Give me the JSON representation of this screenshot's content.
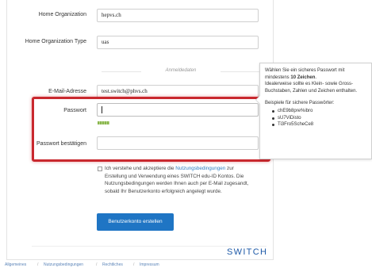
{
  "form": {
    "home_org_label": "Home Organization",
    "home_org_value": "hepvs.ch",
    "home_org_type_label": "Home Organization Type",
    "home_org_type_value": "uas",
    "section_title": "Anmeldedaten",
    "email_label": "E-Mail-Adresse",
    "email_value": "test.switch@phvs.ch",
    "password_label": "Passwort",
    "password_value": "",
    "password_confirm_label": "Passwort bestätigen",
    "password_confirm_value": "",
    "password_strength": 0.15,
    "terms_prefix": "Ich verstehe und akzeptiere die ",
    "terms_link": "Nutzungsbedingungen",
    "terms_suffix": " zur Erstellung und Verwendung eines SWITCH edu-ID Kontos. Die Nutzungsbedingungen werden Ihnen auch per E-Mail zugesandt, sobald Ihr Benutzerkonto erfolgreich angelegt wurde.",
    "terms_checked": false,
    "submit_label": "Benutzerkonto erstellen"
  },
  "tooltip": {
    "line1_prefix": "Wählen Sie ein sicheres Passwort mit mindestens ",
    "line1_bold": "10 Zeichen",
    "line1_suffix": ".",
    "line2": "Idealerweise sollte es Klein- sowie Gross-Buchstaben, Zahlen und Zeichen enthalten.",
    "examples_head": "Beispiele für sichere Passwörter:",
    "examples": [
      "chE9b8pre%ibro",
      "sU7ViDisto",
      "Ti3Fro5ScheCe8"
    ]
  },
  "brand": {
    "name": "SWITCH",
    "color": "#1e5aa8"
  },
  "footer": {
    "links": [
      "Allgemeines",
      "Nutzungsbedingungen",
      "Rechtliches",
      "Impressum"
    ],
    "separator": "/"
  },
  "colors": {
    "highlight": "#c9282e",
    "button": "#1f75c4",
    "link": "#2f7fc1",
    "strength": "#8ab64e"
  }
}
